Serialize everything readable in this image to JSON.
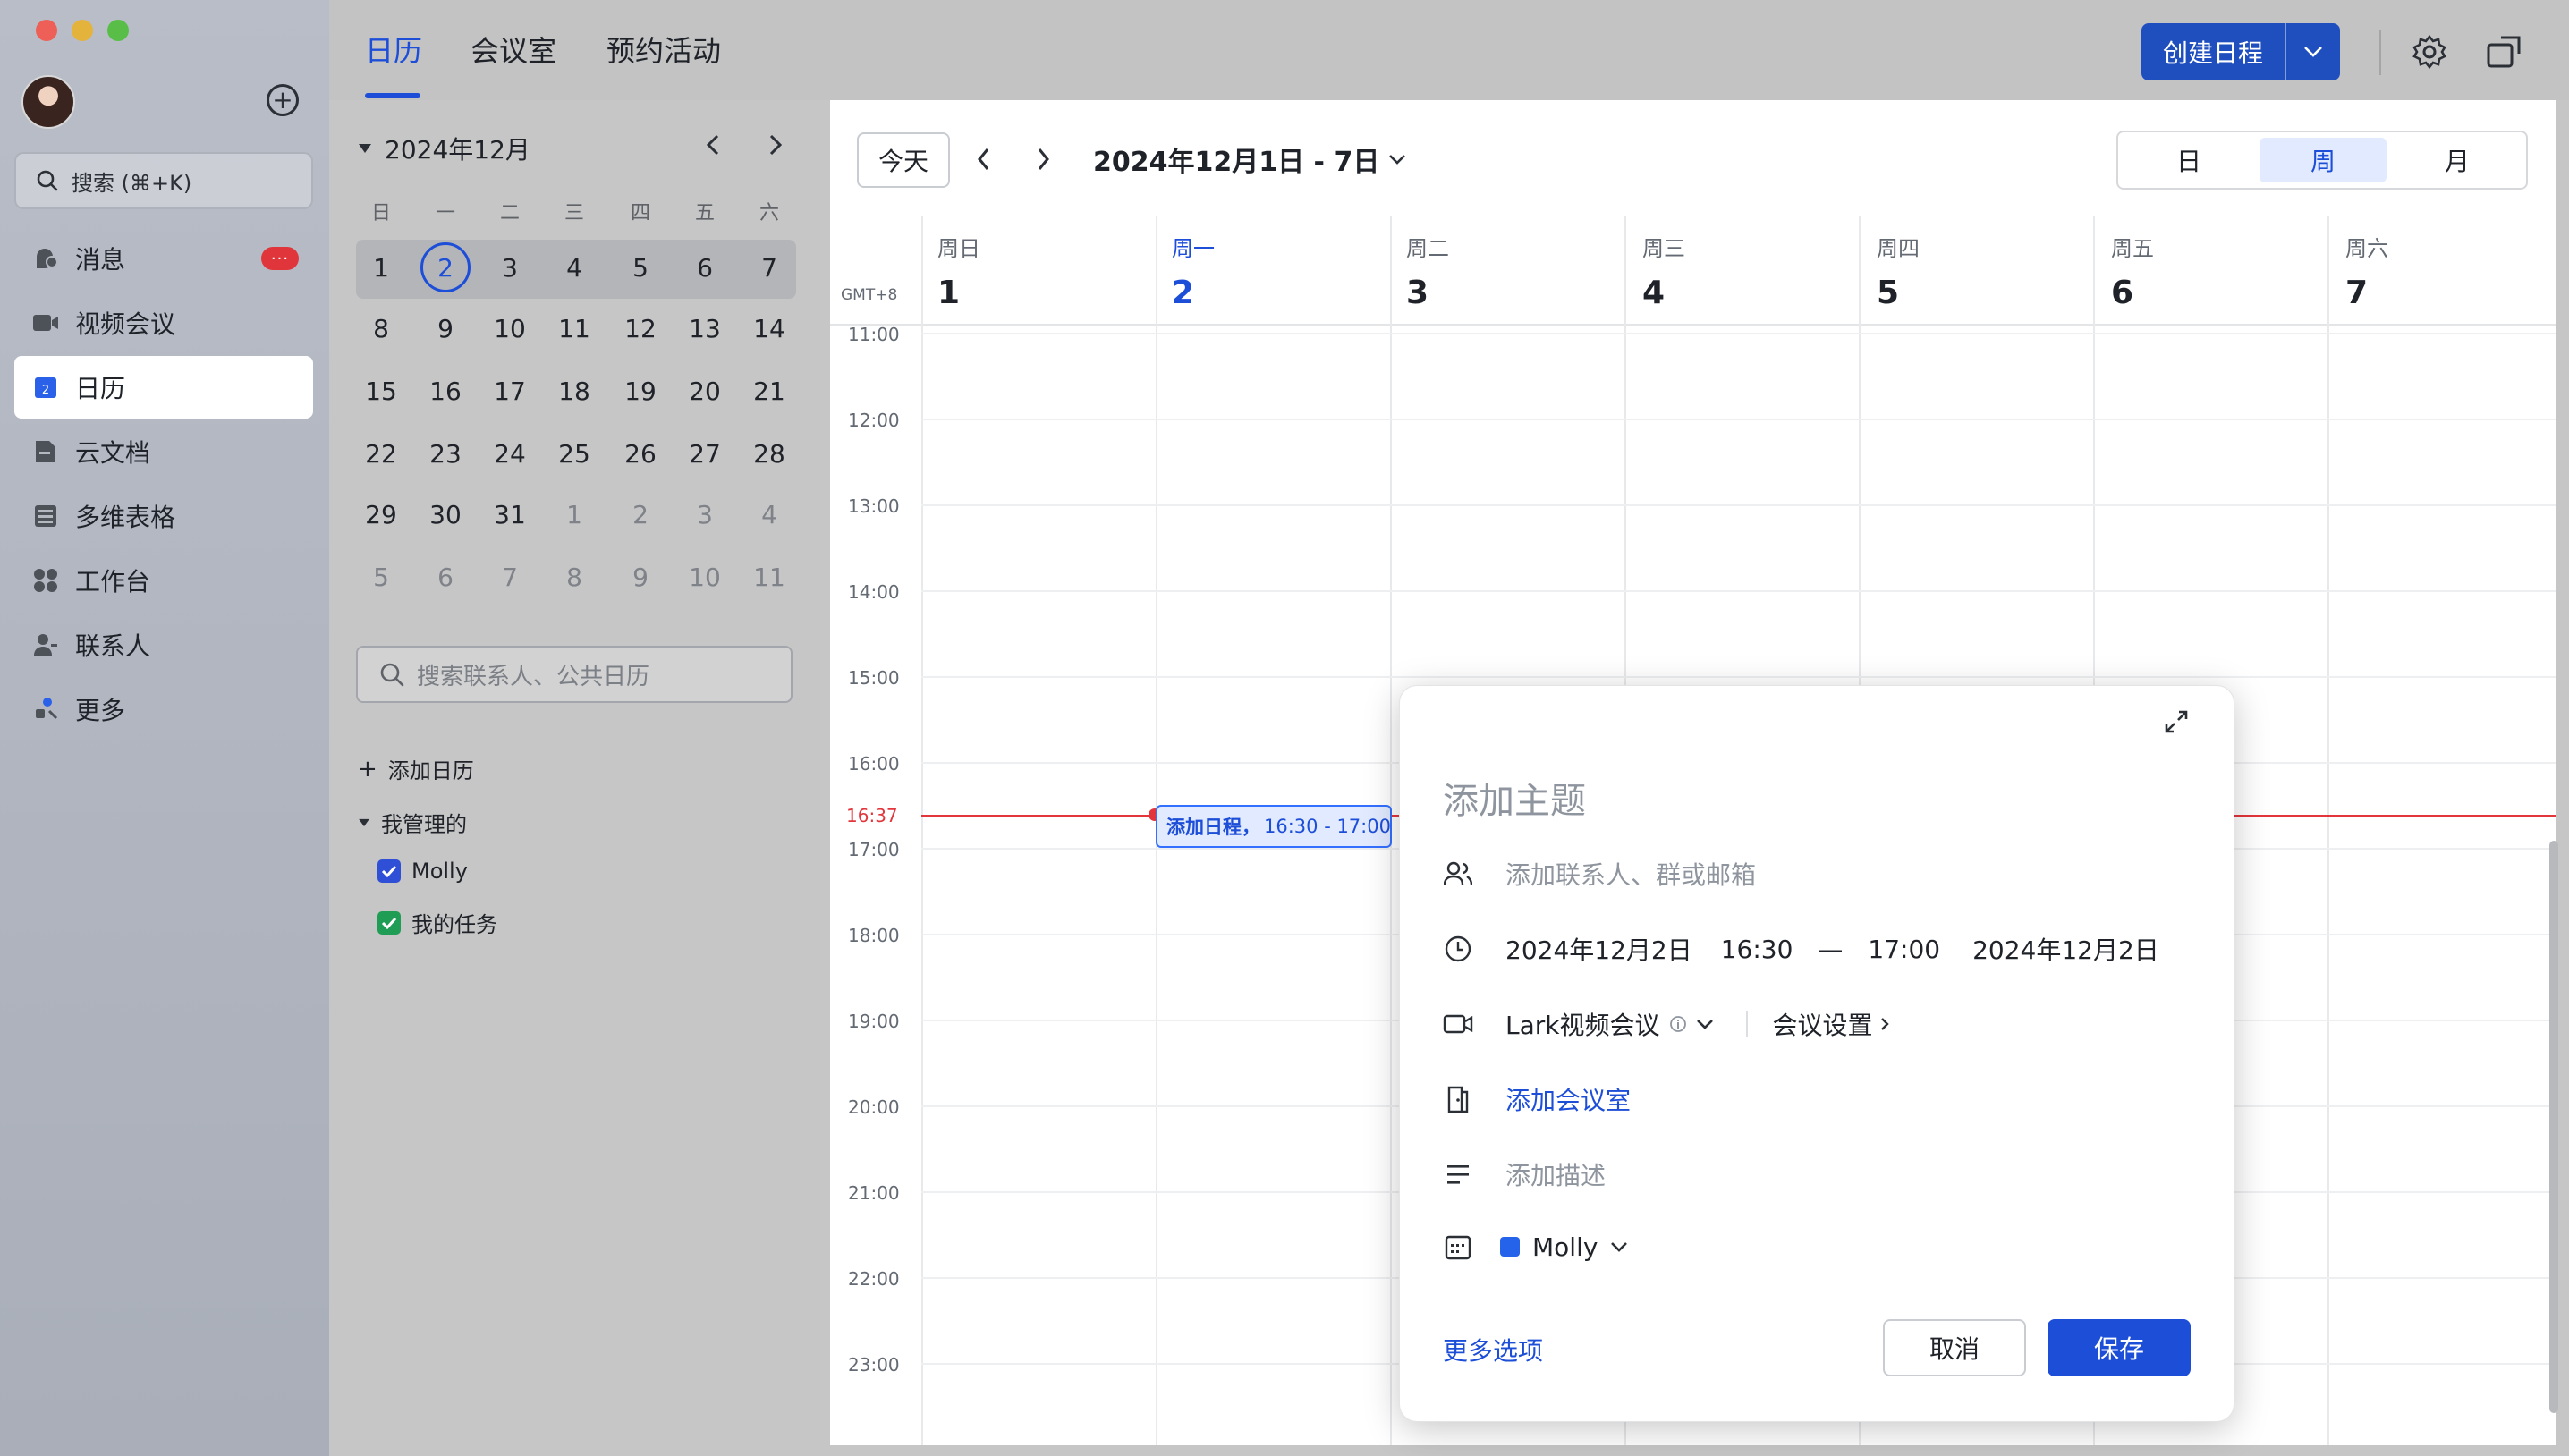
{
  "window": {
    "title": "日历"
  },
  "sidebar": {
    "search_placeholder": "搜索 (⌘+K)",
    "badge": "···",
    "items": [
      {
        "label": "消息",
        "icon": "chat-icon"
      },
      {
        "label": "视频会议",
        "icon": "video-icon"
      },
      {
        "label": "日历",
        "icon": "calendar-icon",
        "active": true
      },
      {
        "label": "云文档",
        "icon": "docs-icon"
      },
      {
        "label": "多维表格",
        "icon": "base-icon"
      },
      {
        "label": "工作台",
        "icon": "workspace-icon"
      },
      {
        "label": "联系人",
        "icon": "contacts-icon"
      },
      {
        "label": "更多",
        "icon": "more-icon"
      }
    ],
    "calendar_icon_day": "2"
  },
  "topbar": {
    "tabs": [
      "日历",
      "会议室",
      "预约活动"
    ],
    "create_label": "创建日程"
  },
  "minical": {
    "month_label": "2024年12月",
    "weekdays": [
      "日",
      "一",
      "二",
      "三",
      "四",
      "五",
      "六"
    ],
    "weeks": [
      [
        "1",
        "2",
        "3",
        "4",
        "5",
        "6",
        "7"
      ],
      [
        "8",
        "9",
        "10",
        "11",
        "12",
        "13",
        "14"
      ],
      [
        "15",
        "16",
        "17",
        "18",
        "19",
        "20",
        "21"
      ],
      [
        "22",
        "23",
        "24",
        "25",
        "26",
        "27",
        "28"
      ],
      [
        "29",
        "30",
        "31",
        "1",
        "2",
        "3",
        "4"
      ],
      [
        "5",
        "6",
        "7",
        "8",
        "9",
        "10",
        "11"
      ]
    ],
    "contact_search_placeholder": "搜索联系人、公共日历",
    "add_calendar": "添加日历",
    "managed_section": "我管理的",
    "calendars": [
      {
        "label": "Molly",
        "color": "#2e4fd6"
      },
      {
        "label": "我的任务",
        "color": "#1f9d55"
      }
    ]
  },
  "toolbar": {
    "today": "今天",
    "range": "2024年12月1日 - 7日",
    "views": [
      "日",
      "周",
      "月"
    ],
    "active_view": "周"
  },
  "grid": {
    "timezone": "GMT+8",
    "days": [
      {
        "name": "周日",
        "date": "1"
      },
      {
        "name": "周一",
        "date": "2",
        "active": true
      },
      {
        "name": "周二",
        "date": "3"
      },
      {
        "name": "周三",
        "date": "4"
      },
      {
        "name": "周四",
        "date": "5"
      },
      {
        "name": "周五",
        "date": "6"
      },
      {
        "name": "周六",
        "date": "7"
      }
    ],
    "times": [
      "11:00",
      "12:00",
      "13:00",
      "14:00",
      "15:00",
      "16:00",
      "17:00",
      "18:00",
      "19:00",
      "20:00",
      "21:00",
      "22:00",
      "23:00"
    ],
    "now_label": "16:37",
    "event": {
      "title": "添加日程，",
      "time": "16:30 - 17:00"
    }
  },
  "dialog": {
    "title_placeholder": "添加主题",
    "attendees_placeholder": "添加联系人、群或邮箱",
    "start_date": "2024年12月2日",
    "start_time": "16:30",
    "dash": "—",
    "end_time": "17:00",
    "end_date": "2024年12月2日",
    "meeting_type": "Lark视频会议",
    "meeting_settings": "会议设置",
    "add_room": "添加会议室",
    "add_description": "添加描述",
    "calendar": "Molly",
    "more_options": "更多选项",
    "cancel": "取消",
    "save": "保存"
  },
  "colors": {
    "accent": "#1d4ed8",
    "now_line": "#e2363c",
    "badge": "#e0363b"
  }
}
